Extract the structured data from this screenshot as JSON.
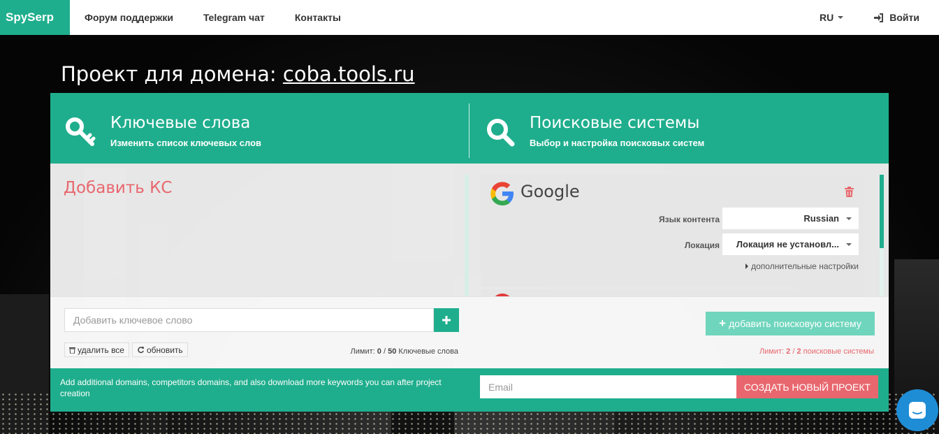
{
  "nav": {
    "brand": "SpySerp",
    "links": [
      "Форум поддержки",
      "Telegram чат",
      "Контакты"
    ],
    "lang": "RU",
    "login": "Войти"
  },
  "page": {
    "title_prefix": "Проект для домена:",
    "domain": "coba.tools.ru"
  },
  "keywords_panel": {
    "title": "Ключевые слова",
    "subtitle": "Изменить список ключевых слов",
    "add_heading": "Добавить КС",
    "input_placeholder": "Добавить ключевое слово",
    "delete_all": "удалить все",
    "refresh": "обновить",
    "limit_label": "Лимит:",
    "limit_used": "0",
    "limit_total": "50",
    "limit_unit": "Ключевые слова"
  },
  "engines_panel": {
    "title": "Поисковые системы",
    "subtitle": "Выбор и настройка поисковых систем",
    "engine": {
      "name": "Google",
      "language_label": "Язык контента",
      "language_value": "Russian",
      "location_label": "Локация",
      "location_value": "Локация не установл...",
      "advanced": "дополнительные настройки"
    },
    "add_button": "добавить поисковую систему",
    "limit_label": "Лимит:",
    "limit_used": "2",
    "limit_total": "2",
    "limit_unit": "поисковые системы"
  },
  "footer": {
    "promo": "Add additional domains, competitors domains, and also download more keywords you can after project creation",
    "email_placeholder": "Email",
    "create_button": "СОЗДАТЬ НОВЫЙ ПРОЕКТ"
  },
  "colors": {
    "accent": "#1fae8d",
    "danger": "#e8676e",
    "chat": "#1f8dd6"
  },
  "icons": [
    "sign-in-icon",
    "key-icon",
    "search-icon",
    "google-logo-icon",
    "trash-icon",
    "plus-icon",
    "refresh-icon",
    "chat-icon"
  ]
}
